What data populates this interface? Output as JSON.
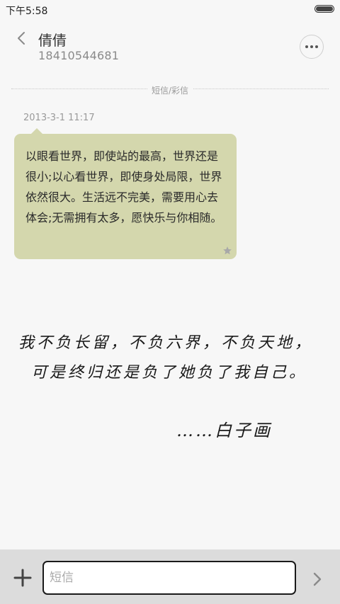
{
  "status_bar": {
    "time": "下午5:58",
    "battery_level": 1.0
  },
  "header": {
    "contact_name": "倩倩",
    "phone_number": "18410544681",
    "back_icon": "chevron-left-icon",
    "more_icon": "more-dots-icon"
  },
  "divider": {
    "label": "短信/彩信"
  },
  "message": {
    "timestamp": "2013-3-1 11:17",
    "text": "以眼看世界，即使站的最高，世界还是很小;以心看世界，即使身处局限，世界依然很大。生活远不完美，需要用心去体会;无需拥有太多，愿快乐与你相随。",
    "starred": true,
    "bubble_color": "#d4d7ad",
    "star_icon": "star-icon"
  },
  "handwriting": {
    "line1": "我不负长留，不负六界，不负天地，",
    "line2": "可是终归还是负了她负了我自己。",
    "signature": "……白子画"
  },
  "input_bar": {
    "placeholder": "短信",
    "add_icon": "plus-icon",
    "send_icon": "chevron-right-icon"
  }
}
